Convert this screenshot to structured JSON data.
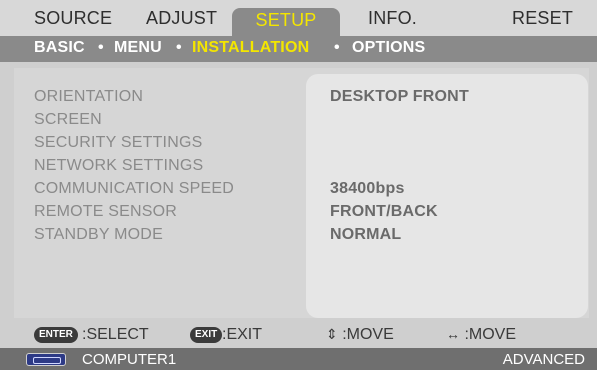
{
  "tabs": [
    {
      "key": "source",
      "label": "SOURCE"
    },
    {
      "key": "adjust",
      "label": "ADJUST"
    },
    {
      "key": "setup",
      "label": "SETUP"
    },
    {
      "key": "info",
      "label": "INFO."
    },
    {
      "key": "reset",
      "label": "RESET"
    }
  ],
  "subtabs": [
    {
      "key": "basic",
      "label": "BASIC"
    },
    {
      "key": "menu",
      "label": "MENU"
    },
    {
      "key": "installation",
      "label": "INSTALLATION"
    },
    {
      "key": "options",
      "label": "OPTIONS"
    }
  ],
  "settings": {
    "rows": [
      {
        "label": "ORIENTATION",
        "value": "DESKTOP FRONT"
      },
      {
        "label": "SCREEN",
        "value": ""
      },
      {
        "label": "SECURITY SETTINGS",
        "value": ""
      },
      {
        "label": "NETWORK SETTINGS",
        "value": ""
      },
      {
        "label": "COMMUNICATION SPEED",
        "value": "38400bps"
      },
      {
        "label": "REMOTE SENSOR",
        "value": "FRONT/BACK"
      },
      {
        "label": "STANDBY MODE",
        "value": "NORMAL"
      }
    ]
  },
  "help": {
    "enter_key": "ENTER",
    "select_label": ":SELECT",
    "exit_key": "EXIT",
    "exit_label": ":EXIT",
    "move_updown_glyph": "⇕",
    "move_updown_label": ":MOVE",
    "move_leftright_glyph": "↔",
    "move_leftright_label": ":MOVE"
  },
  "status": {
    "source": "COMPUTER1",
    "mode": "ADVANCED"
  },
  "colors": {
    "active_tab_text": "#f4e600",
    "active_tab_bg": "#8a8a8a",
    "subbar_bg": "#8a8a8a",
    "statusbar_bg": "#6f6f6f"
  },
  "icons": {
    "status_source_icon": "computer-icon"
  }
}
